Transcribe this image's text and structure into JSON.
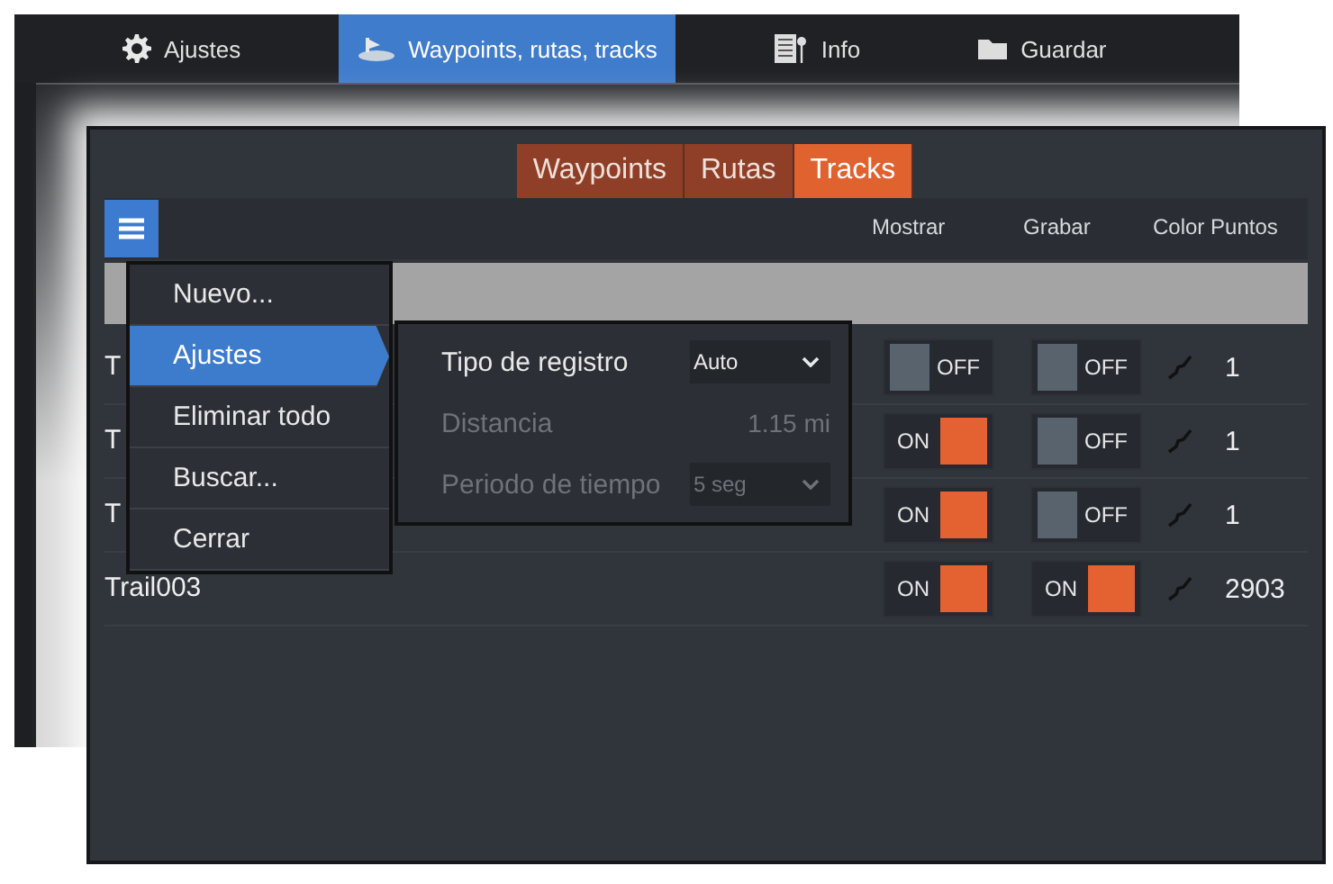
{
  "back_window": {
    "tabs": [
      {
        "label": "Ajustes",
        "selected": false
      },
      {
        "label": "Waypoints, rutas, tracks",
        "selected": true
      },
      {
        "label": "Info",
        "selected": false
      },
      {
        "label": "Guardar",
        "selected": false
      }
    ]
  },
  "front_window": {
    "tabs": [
      {
        "label": "Waypoints",
        "selected": false
      },
      {
        "label": "Rutas",
        "selected": false
      },
      {
        "label": "Tracks",
        "selected": true
      }
    ],
    "columns": [
      "Mostrar",
      "Grabar",
      "Color Puntos"
    ],
    "rows": [
      {
        "name": "T",
        "show": {
          "on": false,
          "label": "OFF"
        },
        "record": {
          "on": false,
          "label": "OFF"
        },
        "points": "1"
      },
      {
        "name": "T",
        "show": {
          "on": true,
          "label": "ON"
        },
        "record": {
          "on": false,
          "label": "OFF"
        },
        "points": "1"
      },
      {
        "name": "T",
        "show": {
          "on": true,
          "label": "ON"
        },
        "record": {
          "on": false,
          "label": "OFF"
        },
        "points": "1"
      },
      {
        "name": "Trail003",
        "show": {
          "on": true,
          "label": "ON"
        },
        "record": {
          "on": true,
          "label": "ON"
        },
        "points": "2903"
      }
    ],
    "menu": [
      {
        "label": "Nuevo...",
        "selected": false
      },
      {
        "label": "Ajustes",
        "selected": true
      },
      {
        "label": "Eliminar todo",
        "selected": false
      },
      {
        "label": "Buscar...",
        "selected": false
      },
      {
        "label": "Cerrar",
        "selected": false
      }
    ],
    "submenu": [
      {
        "kind": "dropdown",
        "label": "Tipo de registro",
        "value": "Auto",
        "disabled": false
      },
      {
        "kind": "readout",
        "label": "Distancia",
        "value": "1.15 mi",
        "disabled": true
      },
      {
        "kind": "dropdown",
        "label": "Periodo de tiempo",
        "value": "5 seg",
        "disabled": true
      }
    ]
  }
}
